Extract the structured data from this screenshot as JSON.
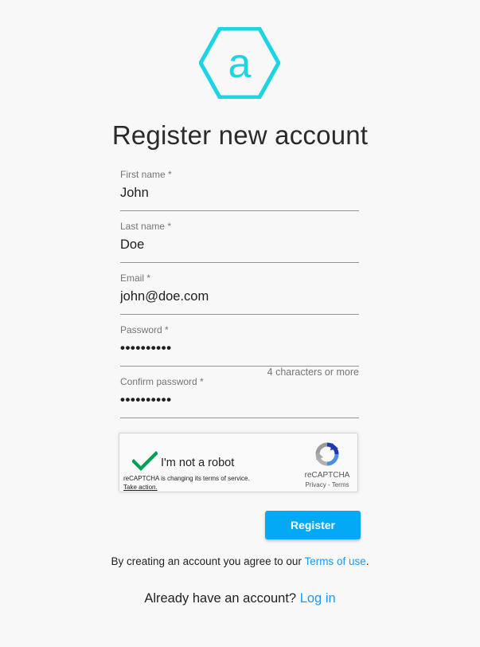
{
  "logo": {
    "letter": "a",
    "color": "#1ed4e3"
  },
  "title": "Register new account",
  "form": {
    "first_name": {
      "label": "First name *",
      "value": "John"
    },
    "last_name": {
      "label": "Last name *",
      "value": "Doe"
    },
    "email": {
      "label": "Email *",
      "value": "john@doe.com"
    },
    "password": {
      "label": "Password *",
      "value": "••••••••••",
      "hint": "4 characters or more"
    },
    "confirm_password": {
      "label": "Confirm password *",
      "value": "••••••••••"
    }
  },
  "captcha": {
    "label": "I'm not a robot",
    "checked": true,
    "notice": "reCAPTCHA is changing its terms of service.",
    "notice_action": "Take action.",
    "brand": "reCAPTCHA",
    "privacy": "Privacy",
    "separator": " - ",
    "terms": "Terms",
    "check_color": "#029e55"
  },
  "register_button": {
    "label": "Register",
    "color": "#03a9f4"
  },
  "terms_text": {
    "prefix": "By creating an account you agree to our ",
    "link": "Terms of use",
    "suffix": "."
  },
  "login_text": {
    "prefix": "Already have an account? ",
    "link": "Log in"
  },
  "accent_color": "#2196f3"
}
